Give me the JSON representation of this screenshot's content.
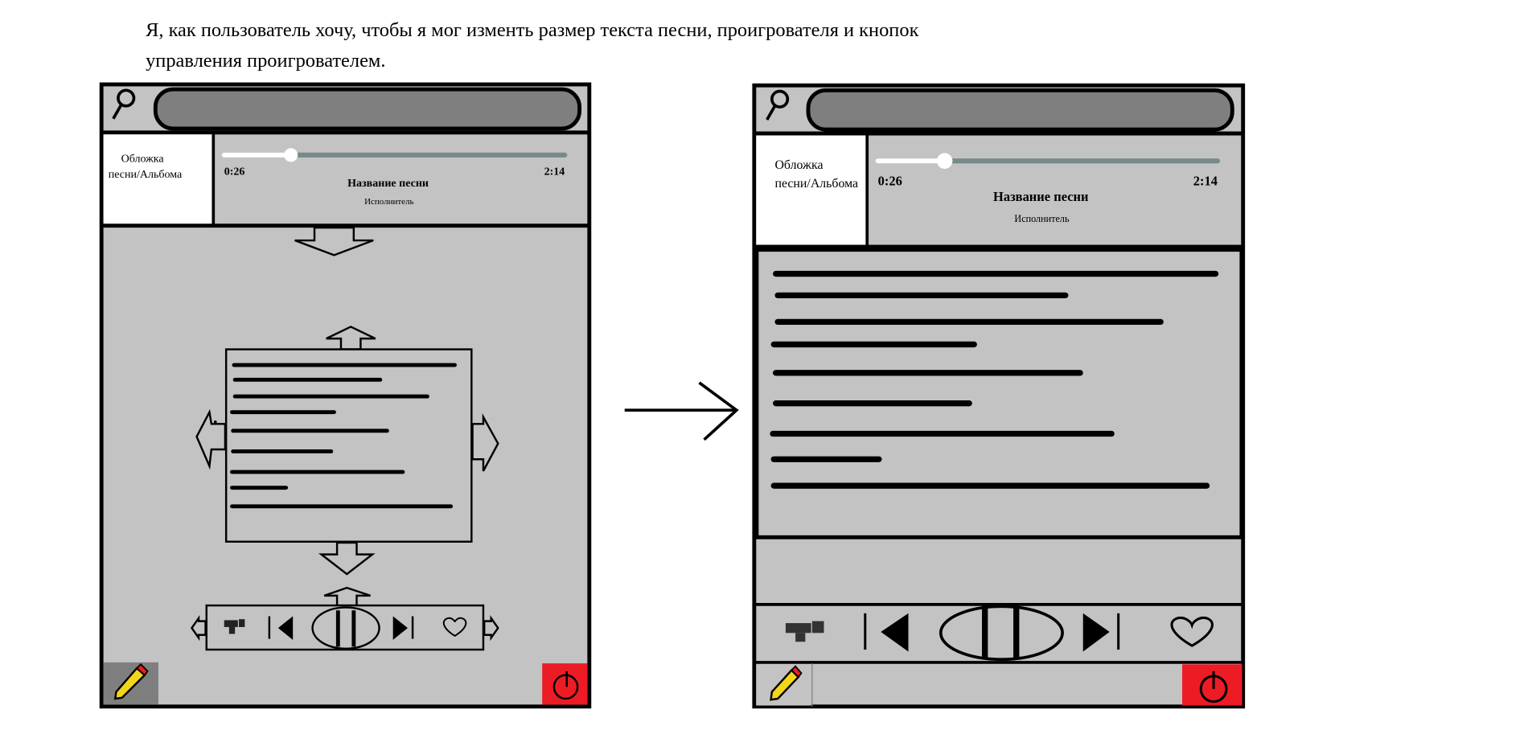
{
  "header": {
    "line1": "Я, как пользователь хочу, чтобы я мог изменть размер текста песни, проигрователя и кнопок",
    "line2": "управления проигрователем."
  },
  "mockup_before": {
    "cover_line1": "Обложка",
    "cover_line2": "песни/Альбома",
    "time_elapsed": "0:26",
    "time_total": "2:14",
    "song_title": "Название песни",
    "artist": "Исполнитель",
    "progress_fraction": 0.19
  },
  "mockup_after": {
    "cover_line1": "Обложка",
    "cover_line2": "песни/Альбома",
    "time_elapsed": "0:26",
    "time_total": "2:14",
    "song_title": "Название песни",
    "artist": "Исполнитель",
    "progress_fraction": 0.19
  },
  "icons": [
    "search-icon",
    "dislike-icon",
    "previous-icon",
    "pause-icon",
    "next-icon",
    "heart-icon",
    "pencil-icon",
    "power-icon",
    "resize-arrow-icon",
    "transition-arrow-icon"
  ],
  "colors": {
    "panel": "#c3c3c3",
    "search_field": "#7f7f7f",
    "slider_track": "#778a8a",
    "power_button": "#ed1c24",
    "edit_button_active": "#7f7f7f"
  }
}
